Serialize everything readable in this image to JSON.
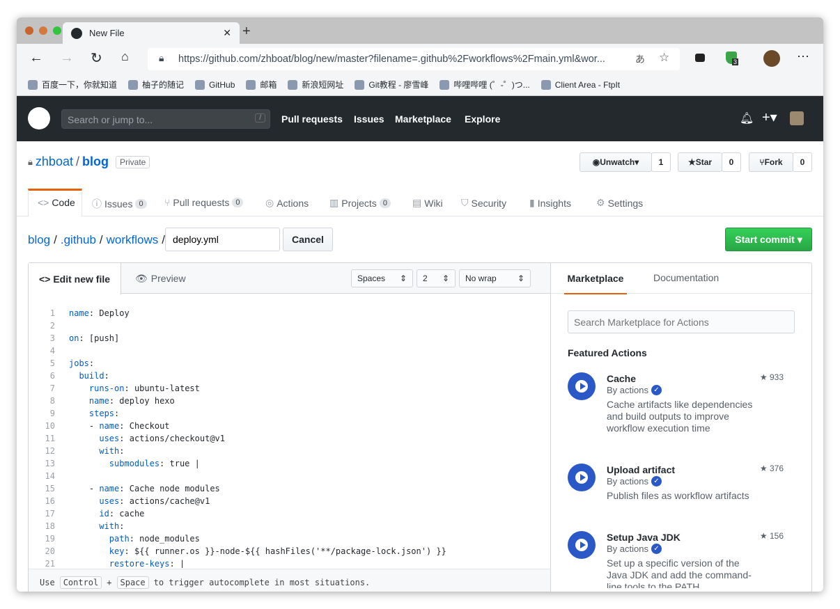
{
  "browser": {
    "tab_title": "New File",
    "url": "https://github.com/zhboat/blog/new/master?filename=.github%2Fworkflows%2Fmain.yml&wor...",
    "extension_badge": "3",
    "bookmarks": [
      "百度一下，你就知道",
      "柚子的随记",
      "GitHub",
      "邮箱",
      "新浪短网址",
      "Git教程 - 廖雪峰",
      "哔哩哔哩 (゜-゜)つ...",
      "Client Area - FtpIt"
    ]
  },
  "github": {
    "search_placeholder": "Search or jump to...",
    "search_key": "/",
    "nav": [
      "Pull requests",
      "Issues",
      "Marketplace",
      "Explore"
    ]
  },
  "repo": {
    "owner": "zhboat",
    "name": "blog",
    "visibility": "Private",
    "unwatch": "Unwatch",
    "watch_count": "1",
    "star": "Star",
    "star_count": "0",
    "fork": "Fork",
    "fork_count": "0",
    "tabs": [
      {
        "label": "Code"
      },
      {
        "label": "Issues",
        "count": "0"
      },
      {
        "label": "Pull requests",
        "count": "0"
      },
      {
        "label": "Actions"
      },
      {
        "label": "Projects",
        "count": "0"
      },
      {
        "label": "Wiki"
      },
      {
        "label": "Security"
      },
      {
        "label": "Insights"
      },
      {
        "label": "Settings"
      }
    ]
  },
  "editor": {
    "breadcrumb": [
      "blog",
      ".github",
      "workflows"
    ],
    "filename": "deploy.yml",
    "cancel": "Cancel",
    "start_commit": "Start commit",
    "tab_edit": "Edit new file",
    "tab_preview": "Preview",
    "indent_mode": "Spaces",
    "indent_size": "2",
    "wrap_mode": "No wrap",
    "lines": [
      {
        "pre": "",
        "key": "name",
        "val": " Deploy"
      },
      {
        "pre": "",
        "key": "",
        "val": ""
      },
      {
        "pre": "",
        "key": "on",
        "val": " [push]"
      },
      {
        "pre": "",
        "key": "",
        "val": ""
      },
      {
        "pre": "",
        "key": "jobs",
        "val": ""
      },
      {
        "pre": "  ",
        "key": "build",
        "val": ""
      },
      {
        "pre": "    ",
        "key": "runs-on",
        "val": " ubuntu-latest"
      },
      {
        "pre": "    ",
        "key": "name",
        "val": " deploy hexo"
      },
      {
        "pre": "    ",
        "key": "steps",
        "val": ""
      },
      {
        "pre": "    - ",
        "key": "name",
        "val": " Checkout"
      },
      {
        "pre": "      ",
        "key": "uses",
        "val": " actions/checkout@v1"
      },
      {
        "pre": "      ",
        "key": "with",
        "val": ""
      },
      {
        "pre": "        ",
        "key": "submodules",
        "val": " true |"
      },
      {
        "pre": "",
        "key": "",
        "val": ""
      },
      {
        "pre": "    - ",
        "key": "name",
        "val": " Cache node modules"
      },
      {
        "pre": "      ",
        "key": "uses",
        "val": " actions/cache@v1"
      },
      {
        "pre": "      ",
        "key": "id",
        "val": " cache"
      },
      {
        "pre": "      ",
        "key": "with",
        "val": ""
      },
      {
        "pre": "        ",
        "key": "path",
        "val": " node_modules"
      },
      {
        "pre": "        ",
        "key": "key",
        "val": " ${{ runner.os }}-node-${{ hashFiles('**/package-lock.json') }}"
      },
      {
        "pre": "        ",
        "key": "restore-keys",
        "val": " |"
      }
    ],
    "hint": {
      "use": "Use",
      "ctrl": "Control",
      "plus": "+",
      "space": "Space",
      "rest": "to trigger autocomplete in most situations."
    }
  },
  "marketplace": {
    "tab_marketplace": "Marketplace",
    "tab_docs": "Documentation",
    "search_placeholder": "Search Marketplace for Actions",
    "featured": "Featured Actions",
    "actions": [
      {
        "title": "Cache",
        "by": "By actions",
        "desc": "Cache artifacts like dependencies and build outputs to improve workflow execution time",
        "stars": "933"
      },
      {
        "title": "Upload artifact",
        "by": "By actions",
        "desc": "Publish files as workflow artifacts",
        "stars": "376"
      },
      {
        "title": "Setup Java JDK",
        "by": "By actions",
        "desc": "Set up a specific version of the Java JDK and add the command-line tools to the PATH",
        "stars": "156"
      }
    ]
  },
  "colors": {
    "accent": "#0366d6",
    "commit_green": "#28a745",
    "header": "#24292e",
    "tab_active": "#e36209"
  }
}
